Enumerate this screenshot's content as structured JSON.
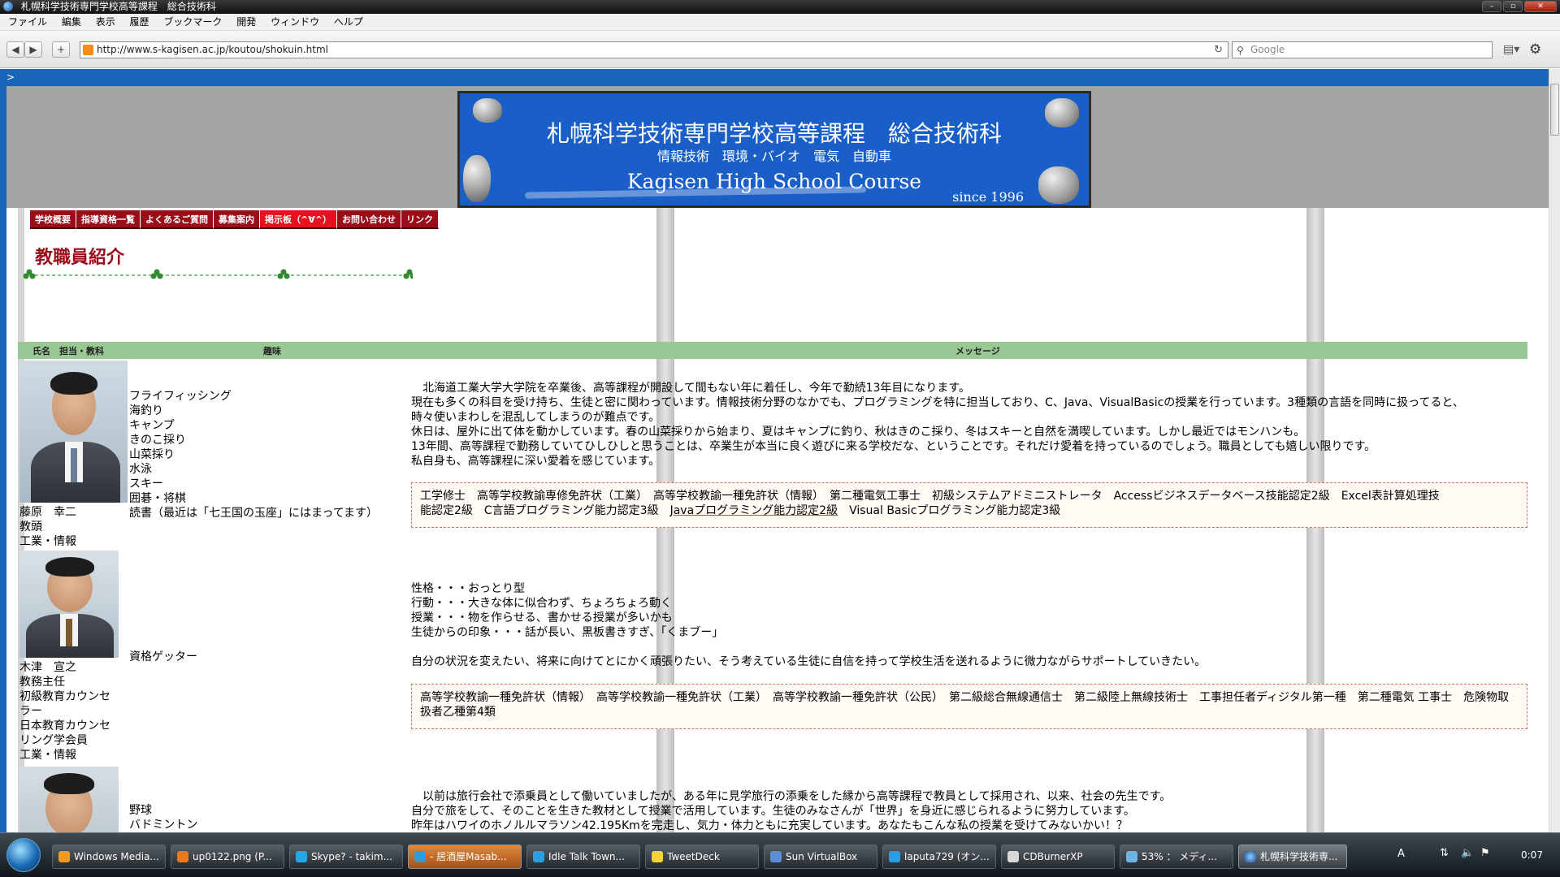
{
  "window": {
    "title": "札幌科学技術専門学校高等課程　総合技術科"
  },
  "menu": [
    "ファイル",
    "編集",
    "表示",
    "履歴",
    "ブックマーク",
    "開発",
    "ウィンドウ",
    "ヘルプ"
  ],
  "toolbar": {
    "url": "http://www.s-kagisen.ac.jp/koutou/shokuin.html",
    "search_placeholder": "Google"
  },
  "page": {
    "prefix_glyph": ">",
    "banner": {
      "title": "札幌科学技術専門学校高等課程　総合技術科",
      "subtitle": "情報技術　環境・バイオ　電気　自動車",
      "english": "Kagisen High School Course",
      "since": "since 1996"
    },
    "nav": [
      "学校概要",
      "指導資格一覧",
      "よくあるご質問",
      "募集案内",
      "掲示板（^∀^）",
      "お問い合わせ",
      "リンク"
    ],
    "nav_active_index": 4,
    "heading": "教職員紹介",
    "table_header": {
      "name": "氏名　担当・教科",
      "hobby": "趣味",
      "message": "メッセージ"
    },
    "staff": [
      {
        "name_block": "藤原　幸二\n教頭\n工業・情報",
        "hobbies": "フライフィッシング\n海釣り\nキャンプ\nきのこ採り\n山菜採り\n水泳\nスキー\n囲碁・将棋\n読書（最近は「七王国の玉座」にはまってます）",
        "message": "　北海道工業大学大学院を卒業後、高等課程が開設して間もない年に着任し、今年で勤続13年目になります。\n現在も多くの科目を受け持ち、生徒と密に関わっています。情報技術分野のなかでも、プログラミングを特に担当しており、C、Java、VisualBasicの授業を行っています。3種類の言語を同時に扱ってると、\n時々使いまわしを混乱してしまうのが難点です。\n休日は、屋外に出て体を動かしています。春の山菜採りから始まり、夏はキャンプに釣り、秋はきのこ採り、冬はスキーと自然を満喫しています。しかし最近ではモンハンも。\n13年間、高等課程で勤務していてひしひしと思うことは、卒業生が本当に良く遊びに来る学校だな、ということです。それだけ愛着を持っているのでしょう。職員としても嬉しい限りです。\n私自身も、高等課程に深い愛着を感じています。",
        "qualifications_line1": "工学修士　高等学校教諭専修免許状（工業）　高等学校教諭一種免許状（情報）　第二種電気工事士　初級システムアドミニストレータ　Accessビジネスデータベース技能認定2級　Excel表計算処理技",
        "qualifications_line2a": "能認定2級　C言語プログラミング能力認定3級　",
        "qualifications_line2b": "Javaプログラミング能力認定2級",
        "qualifications_line2c": "　Visual Basicプログラミング能力認定3級"
      },
      {
        "name_block": "木津　宣之\n教務主任\n初級教育カウンセ\nラー\n日本教育カウンセ\nリング学会員\n工業・情報",
        "hobbies": "資格ゲッター",
        "message": "性格・・・おっとり型\n行動・・・大きな体に似合わず、ちょろちょろ動く\n授業・・・物を作らせる、書かせる授業が多いかも\n生徒からの印象・・・話が長い、黒板書きすぎ、「くまブー」\n\n自分の状況を変えたい、将来に向けてとにかく頑張りたい、そう考えている生徒に自信を持って学校生活を送れるように微力ながらサポートしていきたい。",
        "qualifications": "高等学校教諭一種免許状（情報）　高等学校教諭一種免許状（工業）　高等学校教諭一種免許状（公民）　第二級総合無線通信士　第二級陸上無線技術士　工事担任者ディジタル第一種　第二種電気\n工事士　危険物取扱者乙種第4類"
      },
      {
        "hobbies": "野球\nバドミントン",
        "message": "　以前は旅行会社で添乗員として働いていましたが、ある年に見学旅行の添乗をした縁から高等課程で教員として採用され、以来、社会の先生です。\n自分で旅をして、そのことを生きた教材として授業で活用しています。生徒のみなさんが「世界」を身近に感じられるように努力しています。\n昨年はハワイのホノルルマラソン42.195Kmを完走し、気力・体力ともに充実しています。あなたもこんな私の授業を受けてみないかい！？"
      }
    ]
  },
  "taskbar": {
    "buttons": [
      "Windows Media...",
      "up0122.png (P...",
      "Skype? - takim...",
      "- 居酒屋Masab...",
      "Idle Talk Town...",
      "TweetDeck",
      "Sun VirtualBox",
      "laputa729 (オン...",
      "CDBurnerXP",
      "53% ： メディ...",
      "札幌科学技術専..."
    ],
    "clock": "0:07",
    "tray_text": "A"
  },
  "colors": {
    "accent_red": "#9b0d19",
    "nav_active": "#e6101e",
    "table_header": "#99c894",
    "page_blue": "#1966b9"
  }
}
